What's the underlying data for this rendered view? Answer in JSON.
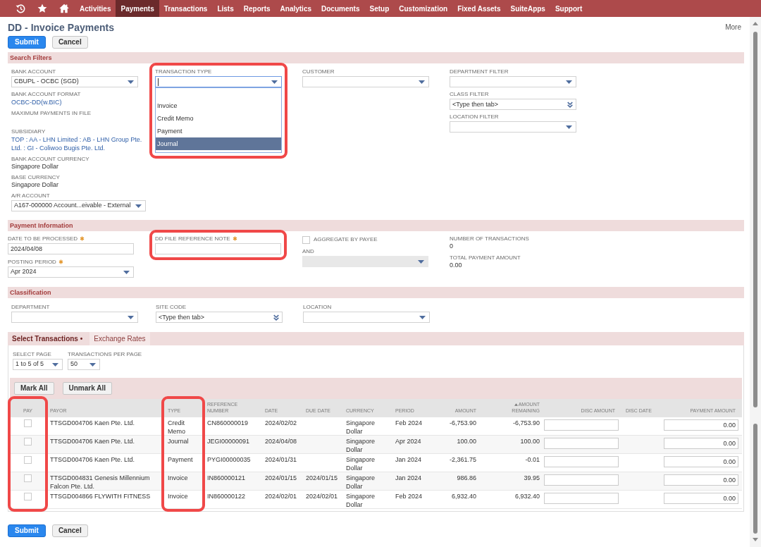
{
  "nav": {
    "items": [
      {
        "label": "Activities",
        "selected": false
      },
      {
        "label": "Payments",
        "selected": true
      },
      {
        "label": "Transactions",
        "selected": false
      },
      {
        "label": "Lists",
        "selected": false
      },
      {
        "label": "Reports",
        "selected": false
      },
      {
        "label": "Analytics",
        "selected": false
      },
      {
        "label": "Documents",
        "selected": false
      },
      {
        "label": "Setup",
        "selected": false
      },
      {
        "label": "Customization",
        "selected": false
      },
      {
        "label": "Fixed Assets",
        "selected": false
      },
      {
        "label": "SuiteApps",
        "selected": false
      },
      {
        "label": "Support",
        "selected": false
      }
    ]
  },
  "page": {
    "title": "DD - Invoice Payments",
    "more": "More"
  },
  "buttons_top": [
    {
      "label": "Submit",
      "kind": "primary"
    },
    {
      "label": "Cancel",
      "kind": "secondary"
    }
  ],
  "search_filters": {
    "title": "Search Filters",
    "columns": [
      [
        {
          "kind": "select",
          "label": "BANK ACCOUNT",
          "value": "CBUPL - OCBC (SGD)"
        },
        {
          "kind": "link",
          "label": "BANK ACCOUNT FORMAT",
          "value": "OCBC-DD(w.BIC)"
        },
        {
          "kind": "text",
          "label": "MAXIMUM PAYMENTS IN FILE"
        },
        {
          "kind": "link",
          "label": "SUBSIDIARY",
          "value": "TOP : AA - LHN Limited : AB - LHN Group Pte. Ltd. : GI - Coliwoo Bugis Pte. Ltd."
        },
        {
          "kind": "text",
          "label": "BANK ACCOUNT CURRENCY",
          "value": "Singapore Dollar"
        },
        {
          "kind": "text",
          "label": "BASE CURRENCY",
          "value": "Singapore Dollar"
        },
        {
          "kind": "select",
          "label": "A/R ACCOUNT",
          "value": "A167-000000 Account...eivable - External"
        }
      ],
      [
        {
          "kind": "select",
          "label": "TRANSACTION TYPE",
          "expanded": true,
          "highlighted": true,
          "options": [
            {
              "label": "Invoice",
              "selected": false
            },
            {
              "label": "Credit Memo",
              "selected": false
            },
            {
              "label": "Payment",
              "selected": false
            },
            {
              "label": "Journal",
              "selected": true
            }
          ]
        }
      ],
      [
        {
          "kind": "select",
          "label": "CUSTOMER"
        }
      ],
      [
        {
          "kind": "select",
          "label": "DEPARTMENT FILTER"
        },
        {
          "kind": "combo",
          "label": "CLASS FILTER",
          "placeholder": "<Type then tab>"
        },
        {
          "kind": "select",
          "label": "LOCATION FILTER"
        }
      ]
    ]
  },
  "payment_information": {
    "title": "Payment Information",
    "columns": [
      [
        {
          "kind": "input",
          "label": "DATE TO BE PROCESSED",
          "required": true,
          "value": "2024/04/08"
        },
        {
          "kind": "select",
          "label": "POSTING PERIOD",
          "required": true,
          "value": "Apr 2024"
        }
      ],
      [
        {
          "kind": "input",
          "label": "DD FILE REFERENCE NOTE",
          "required": true,
          "highlighted": true
        }
      ],
      [
        {
          "kind": "checkbox",
          "label": "AGGREGATE BY PAYEE",
          "checked": false
        },
        {
          "kind": "select",
          "label": "AND",
          "disabled": true
        }
      ],
      [
        {
          "kind": "text",
          "label": "NUMBER OF TRANSACTIONS",
          "value": "0"
        },
        {
          "kind": "text",
          "label": "TOTAL PAYMENT AMOUNT",
          "value": "0.00"
        }
      ]
    ]
  },
  "classification": {
    "title": "Classification",
    "fields": [
      {
        "kind": "select",
        "label": "DEPARTMENT"
      },
      {
        "kind": "combo",
        "label": "SITE CODE",
        "placeholder": "<Type then tab>"
      },
      {
        "kind": "select",
        "label": "LOCATION"
      }
    ]
  },
  "subtabs": [
    {
      "label": "Select Transactions •",
      "selected": true
    },
    {
      "label": "Exchange Rates",
      "selected": false
    }
  ],
  "paging": [
    {
      "kind": "select",
      "label": "SELECT PAGE",
      "value": "1 to 5 of 5"
    },
    {
      "kind": "select",
      "label": "TRANSACTIONS PER PAGE",
      "value": "50"
    }
  ],
  "list_buttons": [
    {
      "label": "Mark All"
    },
    {
      "label": "Unmark All"
    }
  ],
  "table": {
    "columns": [
      {
        "label": "PAY",
        "kind": "checkbox",
        "sorted": false,
        "highlighted": true
      },
      {
        "label": "PAYOR",
        "kind": "text",
        "sorted": false,
        "highlighted": false
      },
      {
        "label": "TYPE",
        "kind": "text",
        "sorted": false,
        "highlighted": true
      },
      {
        "label": "REFERENCE NUMBER",
        "kind": "text",
        "sorted": false,
        "highlighted": false
      },
      {
        "label": "DATE",
        "kind": "text",
        "sorted": false,
        "highlighted": false
      },
      {
        "label": "DUE DATE",
        "kind": "text",
        "sorted": false,
        "highlighted": false
      },
      {
        "label": "CURRENCY",
        "kind": "text",
        "sorted": false,
        "highlighted": false
      },
      {
        "label": "PERIOD",
        "kind": "text",
        "sorted": false,
        "highlighted": false
      },
      {
        "label": "AMOUNT",
        "kind": "amount",
        "sorted": false,
        "highlighted": false
      },
      {
        "label": "AMOUNT REMAINING",
        "kind": "amount",
        "sorted": true,
        "highlighted": false
      },
      {
        "label": "DISC AMOUNT",
        "kind": "input",
        "sorted": false,
        "highlighted": false
      },
      {
        "label": "DISC DATE",
        "kind": "text",
        "sorted": false,
        "highlighted": false
      },
      {
        "label": "PAYMENT AMOUNT",
        "kind": "input",
        "sorted": false,
        "highlighted": false
      }
    ],
    "rows": [
      {
        "pay": false,
        "payor": "TTSGD004706 Kaen Pte. Ltd.",
        "type": "Credit Memo",
        "reference_number": "CN860000019",
        "date": "2024/02/02",
        "currency": "Singapore Dollar",
        "period": "Feb 2024",
        "amount": "-6,753.90",
        "amount_remaining": "-6,753.90",
        "payment_amount": "0.00"
      },
      {
        "pay": false,
        "payor": "TTSGD004706 Kaen Pte. Ltd.",
        "type": "Journal",
        "reference_number": "JEGI00000091",
        "date": "2024/04/08",
        "currency": "Singapore Dollar",
        "period": "Apr 2024",
        "amount": "100.00",
        "amount_remaining": "100.00",
        "payment_amount": "0.00"
      },
      {
        "pay": false,
        "payor": "TTSGD004706 Kaen Pte. Ltd.",
        "type": "Payment",
        "reference_number": "PYGI00000035",
        "date": "2024/01/31",
        "currency": "Singapore Dollar",
        "period": "Jan 2024",
        "amount": "-2,361.75",
        "amount_remaining": "-0.01",
        "payment_amount": "0.00"
      },
      {
        "pay": false,
        "payor": "TTSGD004831 Genesis Millennium Falcon Pte. Ltd.",
        "type": "Invoice",
        "reference_number": "IN860000121",
        "date": "2024/01/15",
        "due_date": "2024/01/15",
        "currency": "Singapore Dollar",
        "period": "Jan 2024",
        "amount": "986.86",
        "amount_remaining": "39.95",
        "payment_amount": "0.00"
      },
      {
        "pay": false,
        "payor": "TTSGD004866 FLYWITH FITNESS",
        "type": "Invoice",
        "reference_number": "IN860000122",
        "date": "2024/02/01",
        "due_date": "2024/02/01",
        "currency": "Singapore Dollar",
        "period": "Feb 2024",
        "amount": "6,932.40",
        "amount_remaining": "6,932.40",
        "payment_amount": "0.00"
      }
    ]
  },
  "buttons_bottom": [
    {
      "label": "Submit",
      "kind": "primary"
    },
    {
      "label": "Cancel",
      "kind": "secondary"
    }
  ]
}
